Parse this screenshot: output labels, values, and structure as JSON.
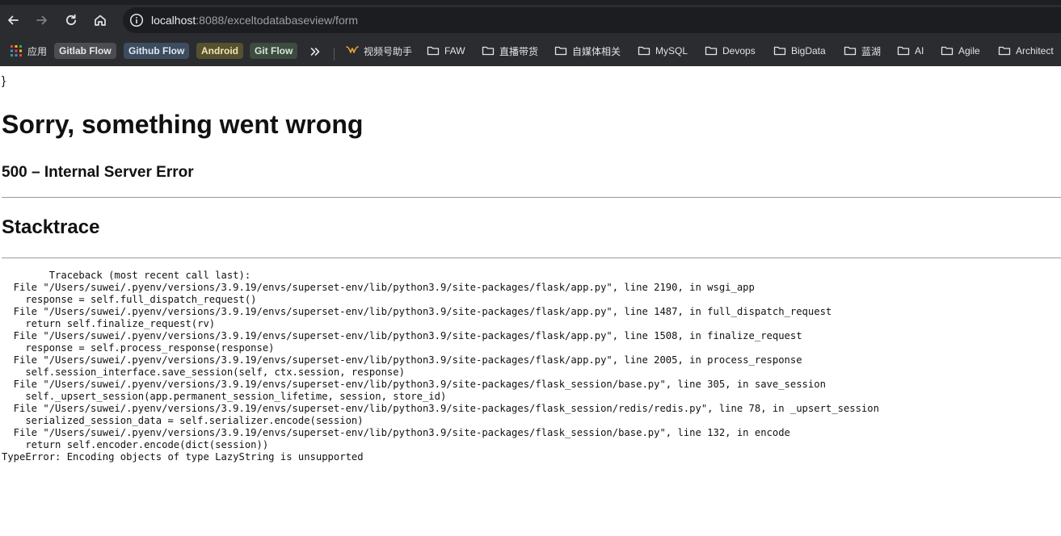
{
  "browser": {
    "url_host": "localhost",
    "url_rest": ":8088/exceltodatabaseview/form",
    "bookmarks": {
      "apps_label": "应用",
      "chips": [
        "Gitlab Flow",
        "Github Flow",
        "Android",
        "Git Flow"
      ],
      "shipinhao_label": "视频号助手",
      "folders": [
        "FAW",
        "直播带货",
        "自媒体相关",
        "MySQL",
        "Devops",
        "BigData",
        "蓝湖",
        "AI",
        "Agile",
        "Architect"
      ]
    }
  },
  "page": {
    "brace": "}",
    "title": "Sorry, something went wrong",
    "subtitle": "500 – Internal Server Error",
    "stacktrace_heading": "Stacktrace",
    "trace_lines": [
      "        Traceback (most recent call last):",
      "  File \"/Users/suwei/.pyenv/versions/3.9.19/envs/superset-env/lib/python3.9/site-packages/flask/app.py\", line 2190, in wsgi_app",
      "    response = self.full_dispatch_request()",
      "  File \"/Users/suwei/.pyenv/versions/3.9.19/envs/superset-env/lib/python3.9/site-packages/flask/app.py\", line 1487, in full_dispatch_request",
      "    return self.finalize_request(rv)",
      "  File \"/Users/suwei/.pyenv/versions/3.9.19/envs/superset-env/lib/python3.9/site-packages/flask/app.py\", line 1508, in finalize_request",
      "    response = self.process_response(response)",
      "  File \"/Users/suwei/.pyenv/versions/3.9.19/envs/superset-env/lib/python3.9/site-packages/flask/app.py\", line 2005, in process_response",
      "    self.session_interface.save_session(self, ctx.session, response)",
      "  File \"/Users/suwei/.pyenv/versions/3.9.19/envs/superset-env/lib/python3.9/site-packages/flask_session/base.py\", line 305, in save_session",
      "    self._upsert_session(app.permanent_session_lifetime, session, store_id)",
      "  File \"/Users/suwei/.pyenv/versions/3.9.19/envs/superset-env/lib/python3.9/site-packages/flask_session/redis/redis.py\", line 78, in _upsert_session",
      "    serialized_session_data = self.serializer.encode(session)",
      "  File \"/Users/suwei/.pyenv/versions/3.9.19/envs/superset-env/lib/python3.9/site-packages/flask_session/base.py\", line 132, in encode",
      "    return self.encoder.encode(dict(session))",
      "TypeError: Encoding objects of type LazyString is unsupported"
    ]
  }
}
